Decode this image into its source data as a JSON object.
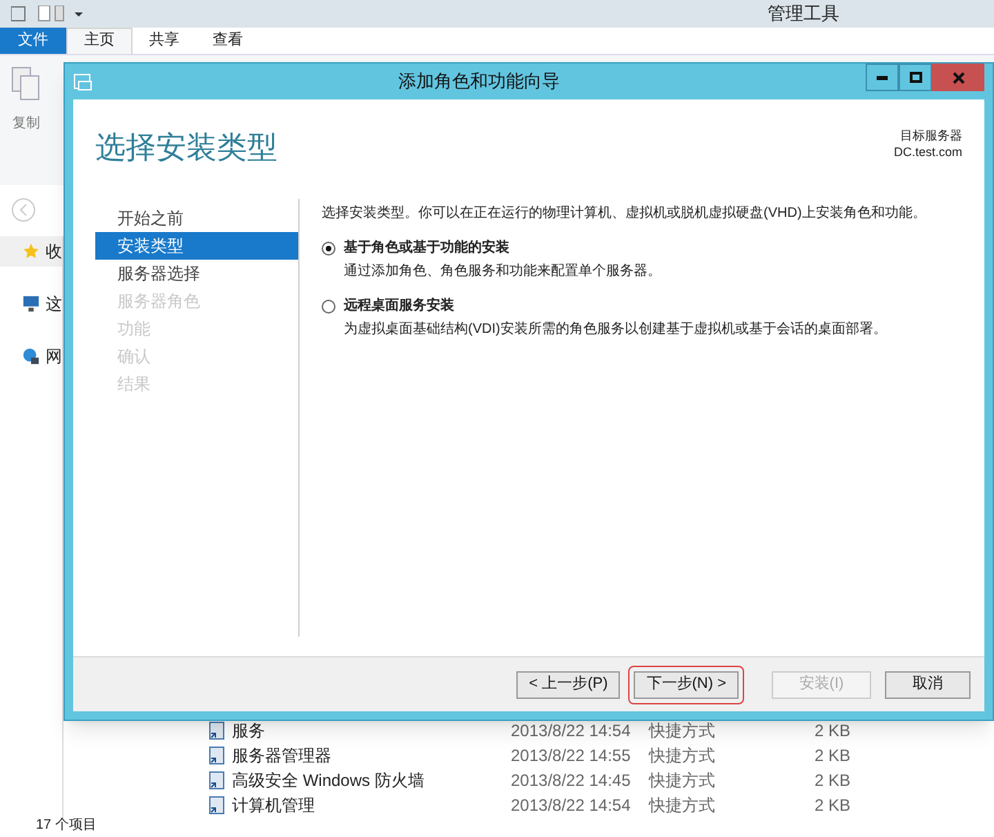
{
  "explorer": {
    "title": "管理工具",
    "file_tab": "文件",
    "tabs": [
      {
        "label": "主页",
        "selected": true
      },
      {
        "label": "共享",
        "selected": false
      },
      {
        "label": "查看",
        "selected": false
      }
    ],
    "ribbon_button": "复制",
    "nav_items": [
      {
        "label": "收",
        "kind": "star",
        "selected": true
      },
      {
        "label": "这",
        "kind": "computer",
        "selected": false
      },
      {
        "label": "网",
        "kind": "network",
        "selected": false
      }
    ],
    "files": [
      {
        "name": "服务",
        "date": "2013/8/22 14:54",
        "type": "快捷方式",
        "size": "2 KB"
      },
      {
        "name": "服务器管理器",
        "date": "2013/8/22 14:55",
        "type": "快捷方式",
        "size": "2 KB"
      },
      {
        "name": "高级安全 Windows 防火墙",
        "date": "2013/8/22 14:45",
        "type": "快捷方式",
        "size": "2 KB"
      },
      {
        "name": "计算机管理",
        "date": "2013/8/22 14:54",
        "type": "快捷方式",
        "size": "2 KB"
      }
    ],
    "status": "17 个项目"
  },
  "dialog": {
    "title": "添加角色和功能向导",
    "heading": "选择安装类型",
    "target_label": "目标服务器",
    "target_server": "DC.test.com",
    "steps": [
      {
        "label": "开始之前",
        "selected": false,
        "disabled": false
      },
      {
        "label": "安装类型",
        "selected": true,
        "disabled": false
      },
      {
        "label": "服务器选择",
        "selected": false,
        "disabled": false
      },
      {
        "label": "服务器角色",
        "selected": false,
        "disabled": true
      },
      {
        "label": "功能",
        "selected": false,
        "disabled": true
      },
      {
        "label": "确认",
        "selected": false,
        "disabled": true
      },
      {
        "label": "结果",
        "selected": false,
        "disabled": true
      }
    ],
    "intro": "选择安装类型。你可以在正在运行的物理计算机、虚拟机或脱机虚拟硬盘(VHD)上安装角色和功能。",
    "options": [
      {
        "label": "基于角色或基于功能的安装",
        "description": "通过添加角色、角色服务和功能来配置单个服务器。",
        "selected": true
      },
      {
        "label": "远程桌面服务安装",
        "description": "为虚拟桌面基础结构(VDI)安装所需的角色服务以创建基于虚拟机或基于会话的桌面部署。",
        "selected": false
      }
    ],
    "buttons": [
      {
        "label": "< 上一步(P)",
        "disabled": false,
        "highlighted": false
      },
      {
        "label": "下一步(N) >",
        "disabled": false,
        "highlighted": true
      },
      {
        "label": "安装(I)",
        "disabled": true,
        "highlighted": false
      },
      {
        "label": "取消",
        "disabled": false,
        "highlighted": false
      }
    ]
  }
}
